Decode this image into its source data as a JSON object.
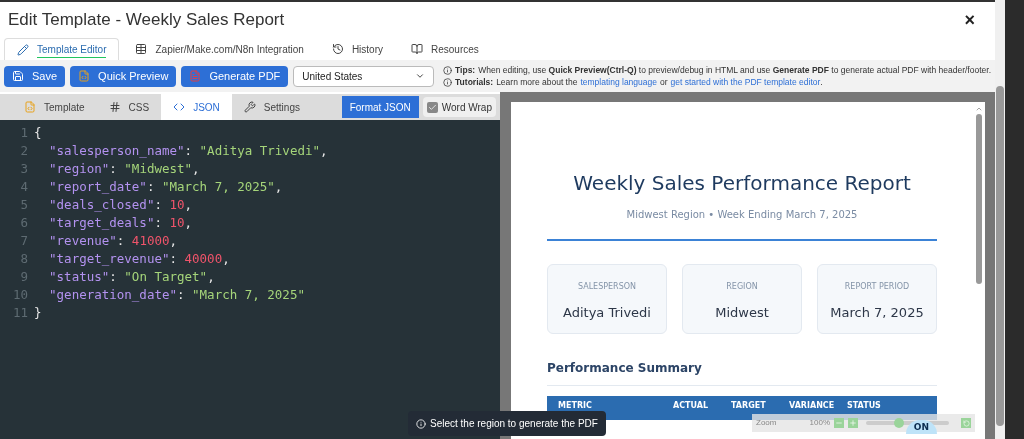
{
  "window": {
    "title": "Edit Template - Weekly Sales Report",
    "close": "×"
  },
  "tabs": [
    {
      "label": "Template Editor",
      "selected": true
    },
    {
      "label": "Zapier/Make.com/N8n Integration",
      "selected": false
    },
    {
      "label": "History",
      "selected": false
    },
    {
      "label": "Resources",
      "selected": false
    }
  ],
  "toolbar": {
    "buttons": [
      {
        "label": "Save"
      },
      {
        "label": "Quick Preview"
      },
      {
        "label": "Generate PDF"
      }
    ],
    "country": "United States",
    "tips": [
      {
        "label": "Tips:",
        "text": "When editing, use **Quick Preview(Ctrl-Q)** to preview/debug in HTML and use **Generate PDF** to generate actual PDF with header/footer."
      },
      {
        "label": "Tutorials:",
        "text": "Learn more about the",
        "links": [
          "templating language",
          "get started with the PDF template editor"
        ],
        "joiner": "or",
        "end": "."
      }
    ]
  },
  "editor_tabs": [
    {
      "label": "Template",
      "selected": false
    },
    {
      "label": "CSS",
      "selected": false
    },
    {
      "label": "JSON",
      "selected": true
    },
    {
      "label": "Settings",
      "selected": false
    }
  ],
  "format_button": "Format JSON",
  "word_wrap": {
    "label": "Word Wrap",
    "checked": true
  },
  "code_lines": [
    {
      "number": "1",
      "tokens": [
        {
          "kind": "punct",
          "text": "{"
        }
      ]
    },
    {
      "number": "2",
      "tokens": [
        {
          "kind": "key",
          "text": "  \"salesperson_name\""
        },
        {
          "kind": "punct",
          "text": ": "
        },
        {
          "kind": "string",
          "text": "\"Aditya Trivedi\""
        },
        {
          "kind": "punct",
          "text": ","
        }
      ]
    },
    {
      "number": "3",
      "tokens": [
        {
          "kind": "key",
          "text": "  \"region\""
        },
        {
          "kind": "punct",
          "text": ": "
        },
        {
          "kind": "string",
          "text": "\"Midwest\""
        },
        {
          "kind": "punct",
          "text": ","
        }
      ]
    },
    {
      "number": "4",
      "tokens": [
        {
          "kind": "key",
          "text": "  \"report_date\""
        },
        {
          "kind": "punct",
          "text": ": "
        },
        {
          "kind": "string",
          "text": "\"March 7, 2025\""
        },
        {
          "kind": "punct",
          "text": ","
        }
      ]
    },
    {
      "number": "5",
      "tokens": [
        {
          "kind": "key",
          "text": "  \"deals_closed\""
        },
        {
          "kind": "punct",
          "text": ": "
        },
        {
          "kind": "number",
          "text": "10"
        },
        {
          "kind": "punct",
          "text": ","
        }
      ]
    },
    {
      "number": "6",
      "tokens": [
        {
          "kind": "key",
          "text": "  \"target_deals\""
        },
        {
          "kind": "punct",
          "text": ": "
        },
        {
          "kind": "number",
          "text": "10"
        },
        {
          "kind": "punct",
          "text": ","
        }
      ]
    },
    {
      "number": "7",
      "tokens": [
        {
          "kind": "key",
          "text": "  \"revenue\""
        },
        {
          "kind": "punct",
          "text": ": "
        },
        {
          "kind": "number",
          "text": "41000"
        },
        {
          "kind": "punct",
          "text": ","
        }
      ]
    },
    {
      "number": "8",
      "tokens": [
        {
          "kind": "key",
          "text": "  \"target_revenue\""
        },
        {
          "kind": "punct",
          "text": ": "
        },
        {
          "kind": "number",
          "text": "40000"
        },
        {
          "kind": "punct",
          "text": ","
        }
      ]
    },
    {
      "number": "9",
      "tokens": [
        {
          "kind": "key",
          "text": "  \"status\""
        },
        {
          "kind": "punct",
          "text": ": "
        },
        {
          "kind": "string",
          "text": "\"On Target\""
        },
        {
          "kind": "punct",
          "text": ","
        }
      ]
    },
    {
      "number": "10",
      "tokens": [
        {
          "kind": "key",
          "text": "  \"generation_date\""
        },
        {
          "kind": "punct",
          "text": ": "
        },
        {
          "kind": "string",
          "text": "\"March 7, 2025\""
        }
      ]
    },
    {
      "number": "11",
      "tokens": [
        {
          "kind": "punct",
          "text": "}"
        }
      ]
    }
  ],
  "preview": {
    "title": "Weekly Sales Performance Report",
    "subtitle": "Midwest Region • Week Ending March 7, 2025",
    "cards": [
      {
        "label": "SALESPERSON",
        "value": "Aditya Trivedi"
      },
      {
        "label": "REGION",
        "value": "Midwest"
      },
      {
        "label": "REPORT PERIOD",
        "value": "March 7, 2025"
      }
    ],
    "section": "Performance Summary",
    "table": {
      "columns": [
        "METRIC",
        "ACTUAL",
        "TARGET",
        "VARIANCE",
        "STATUS"
      ],
      "badge": "ON"
    }
  },
  "tooltip": "Select the region to generate the PDF",
  "zoom": {
    "label": "Zoom",
    "value": "100%",
    "level": 0.4
  }
}
